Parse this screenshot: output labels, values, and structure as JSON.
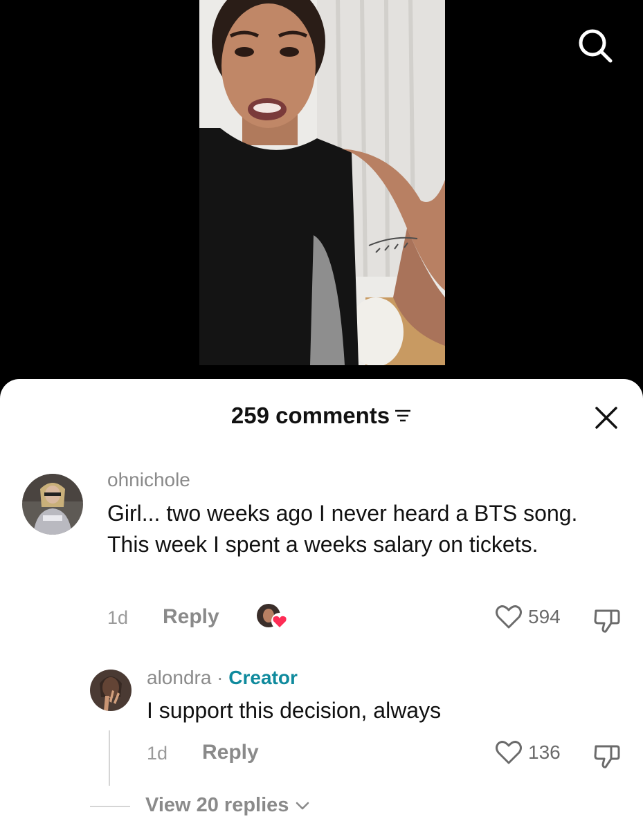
{
  "sheet": {
    "comment_count": "259 comments"
  },
  "comments": [
    {
      "username": "ohnichole",
      "text": "Girl... two weeks ago I never heard a BTS song. This week I spent a weeks salary on tickets.",
      "time": "1d",
      "reply_label": "Reply",
      "likes": "594"
    }
  ],
  "reply": {
    "username": "alondra",
    "separator": " · ",
    "creator_label": "Creator",
    "text": "I support this decision, always",
    "time": "1d",
    "reply_label": "Reply",
    "likes": "136"
  },
  "view_replies": "View 20 replies"
}
